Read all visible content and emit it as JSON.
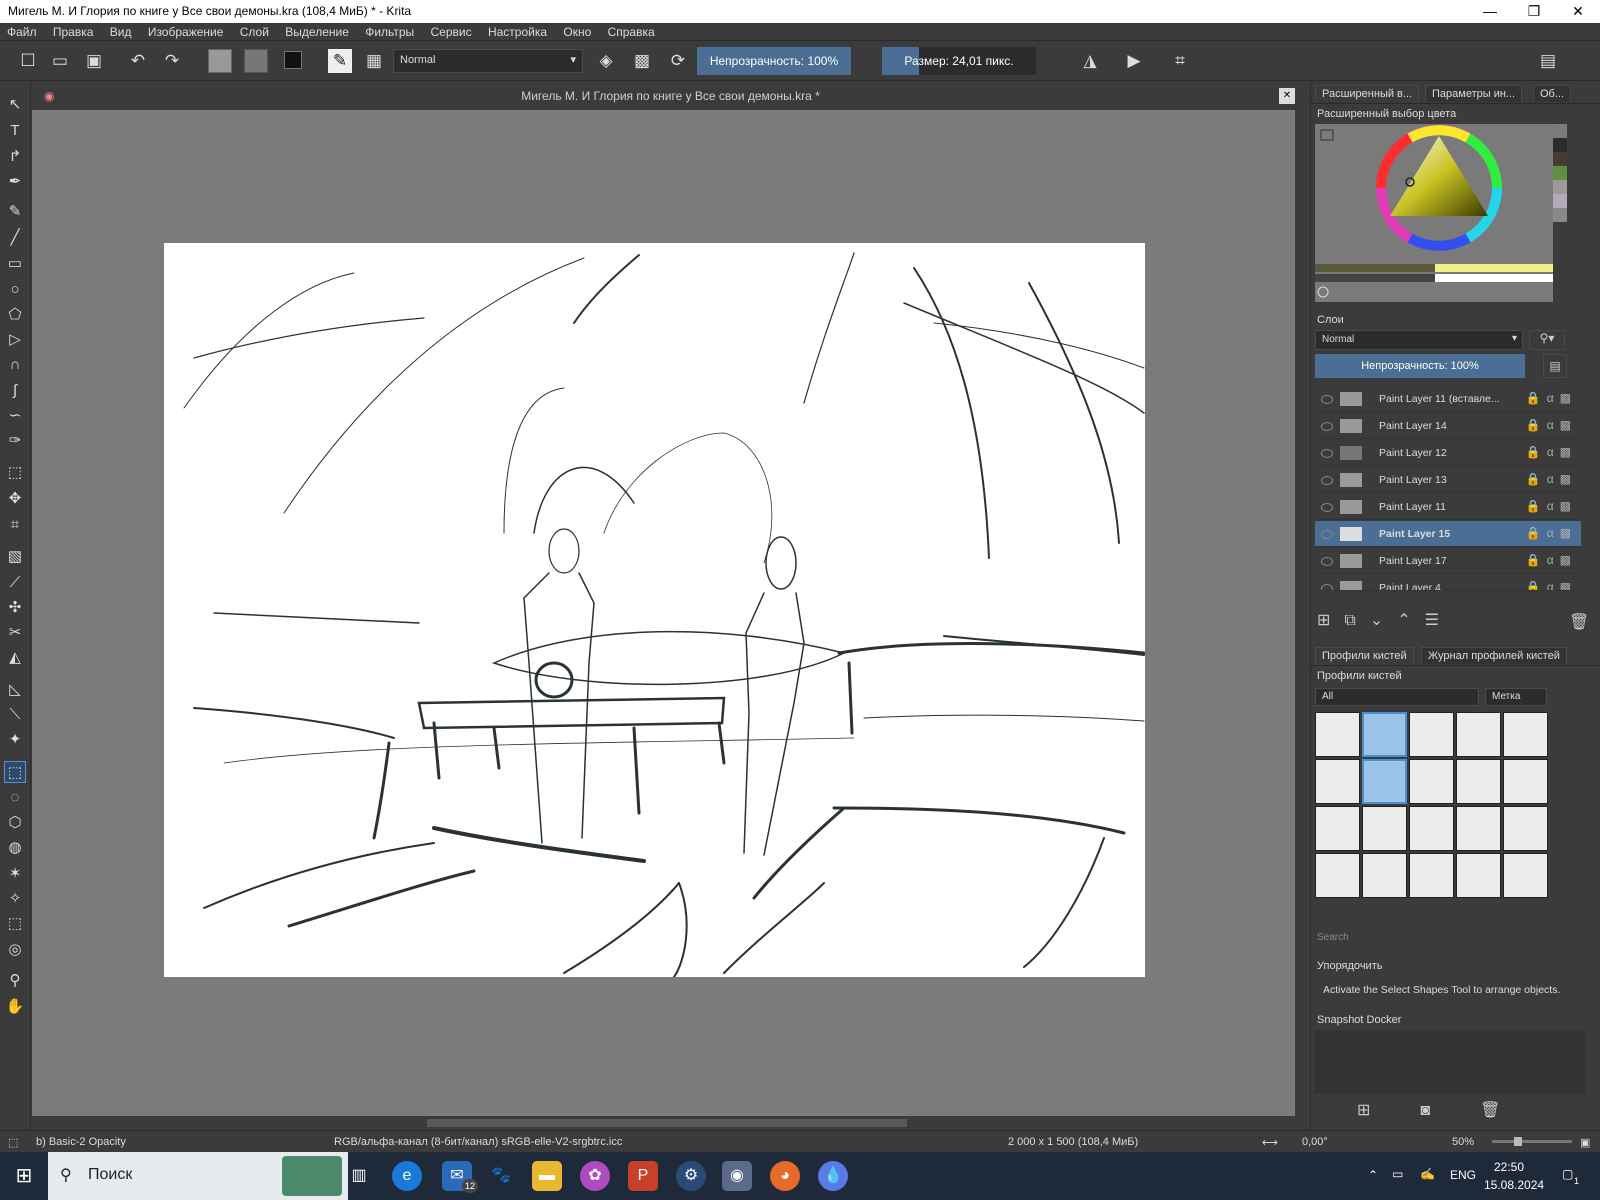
{
  "window": {
    "title": "Мигель М. И Глория по книге у Все свои демоны.kra (108,4 МиБ)  * - Krita",
    "controls": {
      "minimize": "—",
      "maximize": "❐",
      "close": "✕"
    }
  },
  "menu": [
    "Файл",
    "Правка",
    "Вид",
    "Изображение",
    "Слой",
    "Выделение",
    "Фильтры",
    "Сервис",
    "Настройка",
    "Окно",
    "Справка"
  ],
  "toolbar": {
    "blend_mode": "Normal",
    "opacity_label": "Непрозрачность: 100%",
    "size_label": "Размер: 24,01 пикс.",
    "size_fill_fraction": 0.24
  },
  "document_tab": {
    "title": "Мигель М. И Глория по книге у Все свои демоны.kra *",
    "close": "✕"
  },
  "panels": {
    "tabs": [
      "Расширенный в...",
      "Параметры ин...",
      "Об..."
    ],
    "color_selector_title": "Расширенный выбор цвета",
    "layers": {
      "title": "Слои",
      "blend_mode": "Normal",
      "opacity_label": "Непрозрачность:  100%",
      "items": [
        {
          "name": "Paint Layer 11 (вставле...",
          "selected": false
        },
        {
          "name": "Paint Layer 14",
          "selected": false
        },
        {
          "name": "Paint Layer 12",
          "selected": false
        },
        {
          "name": "Paint Layer 13",
          "selected": false
        },
        {
          "name": "Paint Layer 11",
          "selected": false
        },
        {
          "name": "Paint Layer 15",
          "selected": true
        },
        {
          "name": "Paint Layer 17",
          "selected": false
        },
        {
          "name": "Paint Layer 4",
          "selected": false
        }
      ]
    },
    "brush_tabs": [
      "Профили кистей",
      "Журнал профилей кистей"
    ],
    "brush_title": "Профили кистей",
    "brush_filter": "All",
    "brush_tag": "Метка",
    "brush_search_placeholder": "Search",
    "arrange_title": "Упорядочить",
    "arrange_text": "Activate the Select Shapes Tool to arrange objects.",
    "snapshot_title": "Snapshot Docker"
  },
  "status": {
    "brush_preset": "b) Basic-2 Opacity",
    "color_space": "RGB/альфа-канал (8-бит/канал)  sRGB-elle-V2-srgbtrc.icc",
    "image_size": "2 000 x 1 500 (108,4 МиБ)",
    "rotation": "0,00°",
    "zoom": "50%"
  },
  "taskbar": {
    "search_placeholder": "Поиск",
    "mail_badge": "12",
    "lang": "ENG",
    "time": "22:50",
    "date": "15.08.2024",
    "notify_count": "1"
  },
  "colors": {
    "accent": "#4a6e94",
    "panel": "#3b3b3b",
    "canvas_bg": "#7b7b7b",
    "stroke": "#2a3333"
  }
}
